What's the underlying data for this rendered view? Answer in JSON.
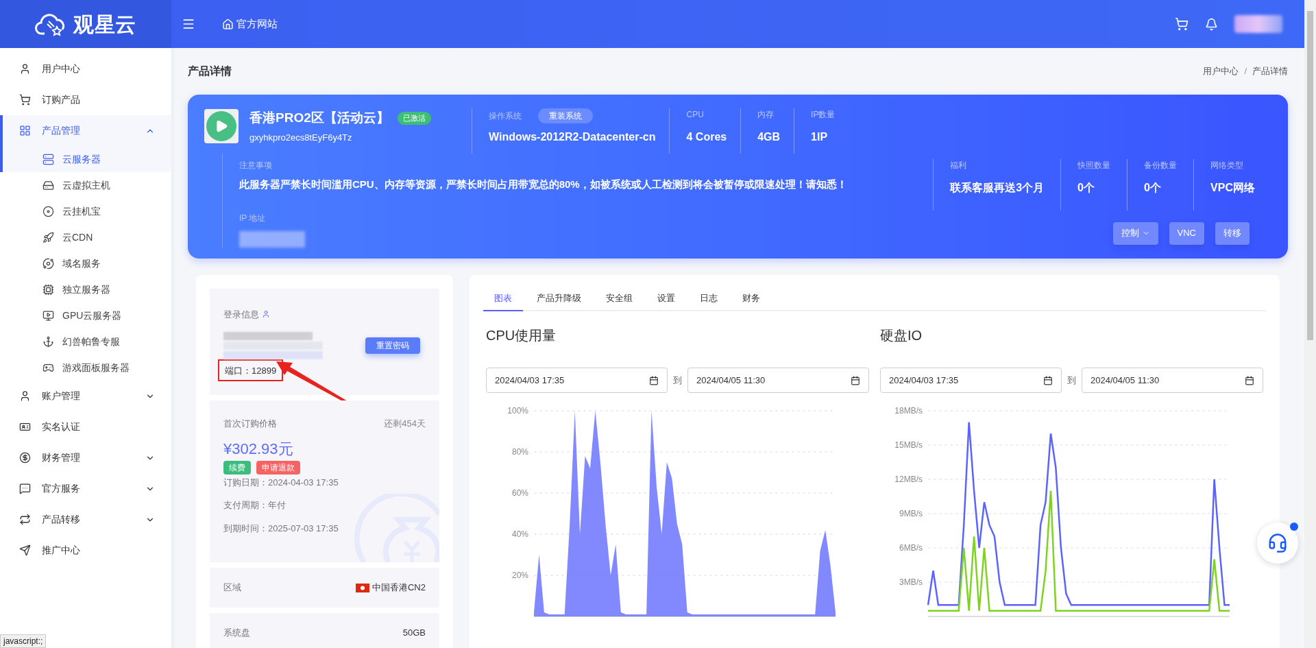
{
  "header": {
    "logo_text": "观星云",
    "nav_link": "官方网站"
  },
  "sidebar": {
    "items": [
      {
        "label": "用户中心",
        "selected": false
      },
      {
        "label": "订购产品",
        "selected": false
      },
      {
        "label": "产品管理",
        "selected": true,
        "expanded": true,
        "children": [
          {
            "label": "云服务器",
            "selected": true
          },
          {
            "label": "云虚拟主机",
            "selected": false
          },
          {
            "label": "云挂机宝",
            "selected": false
          },
          {
            "label": "云CDN",
            "selected": false
          },
          {
            "label": "域名服务",
            "selected": false
          },
          {
            "label": "独立服务器",
            "selected": false
          },
          {
            "label": "GPU云服务器",
            "selected": false
          },
          {
            "label": "幻兽帕鲁专服",
            "selected": false
          },
          {
            "label": "游戏面板服务器",
            "selected": false
          }
        ]
      },
      {
        "label": "账户管理",
        "selected": false,
        "expanded": false
      },
      {
        "label": "实名认证",
        "selected": false
      },
      {
        "label": "财务管理",
        "selected": false,
        "expanded": false
      },
      {
        "label": "官方服务",
        "selected": false,
        "expanded": false
      },
      {
        "label": "产品转移",
        "selected": false,
        "expanded": false
      },
      {
        "label": "推广中心",
        "selected": false
      }
    ]
  },
  "page": {
    "title": "产品详情",
    "breadcrumb": [
      "用户中心",
      "产品详情"
    ],
    "breadcrumb_separator": "/"
  },
  "product": {
    "name": "香港PRO2区【活动云】",
    "status": "已激活",
    "id": "gxyhkpro2ecs8tEyF6y4Tz",
    "specs": [
      {
        "label": "操作系统",
        "value": "Windows-2012R2-Datacenter-cn",
        "action": "重装系统"
      },
      {
        "label": "CPU",
        "value": "4 Cores"
      },
      {
        "label": "内存",
        "value": "4GB"
      },
      {
        "label": "IP数量",
        "value": "1IP"
      }
    ],
    "notice": {
      "label": "注意事项",
      "text": "此服务器严禁长时间滥用CPU、内存等资源，严禁长时间占用带宽总的80%，如被系统或人工检测到将会被暂停或限速处理！请知悉！"
    },
    "ip_label": "IP 地址",
    "extras": [
      {
        "label": "福利",
        "value": "联系客服再送3个月"
      },
      {
        "label": "快照数量",
        "value": "0个"
      },
      {
        "label": "备份数量",
        "value": "0个"
      },
      {
        "label": "网络类型",
        "value": "VPC网络"
      }
    ],
    "actions": [
      {
        "label": "控制",
        "dropdown": true
      },
      {
        "label": "VNC",
        "dropdown": false
      },
      {
        "label": "转移",
        "dropdown": false
      }
    ]
  },
  "login": {
    "title": "登录信息",
    "reset_button": "重置密码",
    "port": "端口：12899"
  },
  "billing": {
    "title": "首次订购价格",
    "remaining": "还剩454天",
    "price": "¥302.93元",
    "buttons": [
      {
        "label": "续费",
        "color": "#3dbd7d"
      },
      {
        "label": "申请退款",
        "color": "#f56464"
      }
    ],
    "rows": [
      "订购日期：2024-04-03 17:35",
      "支付周期：年付",
      "到期时间：2025-07-03 17:35"
    ]
  },
  "info_rows": [
    {
      "label": "区域",
      "value": "中国香港CN2",
      "flag": true
    },
    {
      "label": "系统盘",
      "value": "50GB",
      "flag": false
    }
  ],
  "tabs": [
    {
      "label": "图表",
      "selected": true
    },
    {
      "label": "产品升降级",
      "selected": false
    },
    {
      "label": "安全组",
      "selected": false
    },
    {
      "label": "设置",
      "selected": false
    },
    {
      "label": "日志",
      "selected": false
    },
    {
      "label": "财务",
      "selected": false
    }
  ],
  "charts": [
    {
      "date_from": "2024/04/03 17:35",
      "separator": "到",
      "date_to": "2024/04/05 11:30",
      "chart_data": {
        "type": "area",
        "title": "CPU使用量",
        "ylim": [
          0,
          100
        ],
        "grid": true,
        "yticks": [
          {
            "value": 20,
            "label": "20%"
          },
          {
            "value": 40,
            "label": "40%"
          },
          {
            "value": 60,
            "label": "60%"
          },
          {
            "value": 80,
            "label": "80%"
          },
          {
            "value": 100,
            "label": "100%"
          }
        ],
        "series": [
          {
            "color": "#6c74ff",
            "values": [
              2,
              30,
              2,
              1,
              1,
              1,
              1,
              45,
              100,
              40,
              78,
              72,
              100,
              75,
              45,
              20,
              35,
              2,
              1,
              1,
              1,
              1,
              1,
              100,
              63,
              40,
              75,
              67,
              45,
              35,
              2,
              1,
              1,
              1,
              1,
              1,
              1,
              1,
              1,
              1,
              1,
              1,
              1,
              1,
              1,
              1,
              1,
              1,
              1,
              1,
              1,
              1,
              1,
              1,
              1,
              1,
              32,
              42,
              25,
              2
            ]
          }
        ]
      }
    },
    {
      "date_from": "2024/04/03 17:35",
      "separator": "到",
      "date_to": "2024/04/05 11:30",
      "chart_data": {
        "type": "line",
        "title": "硬盘IO",
        "ylim": [
          0,
          18
        ],
        "grid": true,
        "yticks": [
          {
            "value": 3,
            "label": "3MB/s"
          },
          {
            "value": 6,
            "label": "6MB/s"
          },
          {
            "value": 9,
            "label": "9MB/s"
          },
          {
            "value": 12,
            "label": "12MB/s"
          },
          {
            "value": 15,
            "label": "15MB/s"
          },
          {
            "value": 18,
            "label": "18MB/s"
          }
        ],
        "series": [
          {
            "color": "#5b63ff",
            "values": [
              1,
              4,
              1,
              1,
              1,
              1,
              1,
              8,
              17,
              11,
              6,
              10,
              8,
              7,
              3,
              1,
              1,
              1,
              1,
              1,
              1,
              1,
              8,
              10,
              16,
              13,
              6,
              2,
              1,
              1,
              1,
              1,
              1,
              1,
              1,
              1,
              1,
              1,
              1,
              1,
              1,
              1,
              1,
              1,
              1,
              1,
              1,
              1,
              1,
              1,
              1,
              1,
              1,
              1,
              1,
              1,
              12,
              6,
              1,
              1
            ]
          },
          {
            "color": "#7ed321",
            "values": [
              0.5,
              0.5,
              0.5,
              0.5,
              0.5,
              0.5,
              0.5,
              6,
              0.5,
              7,
              0.5,
              6,
              0.5,
              0.5,
              0.5,
              0.5,
              0.5,
              0.5,
              0.5,
              0.5,
              0.5,
              0.5,
              0.5,
              4,
              11,
              0.5,
              0.5,
              0.5,
              0.5,
              0.5,
              0.5,
              0.5,
              0.5,
              0.5,
              0.5,
              0.5,
              0.5,
              0.5,
              0.5,
              0.5,
              0.5,
              0.5,
              0.5,
              0.5,
              0.5,
              0.5,
              0.5,
              0.5,
              0.5,
              0.5,
              0.5,
              0.5,
              0.5,
              0.5,
              0.5,
              0.5,
              5,
              0.5,
              0.5,
              0.5
            ]
          }
        ]
      }
    }
  ],
  "status_bar": "javascript:;"
}
